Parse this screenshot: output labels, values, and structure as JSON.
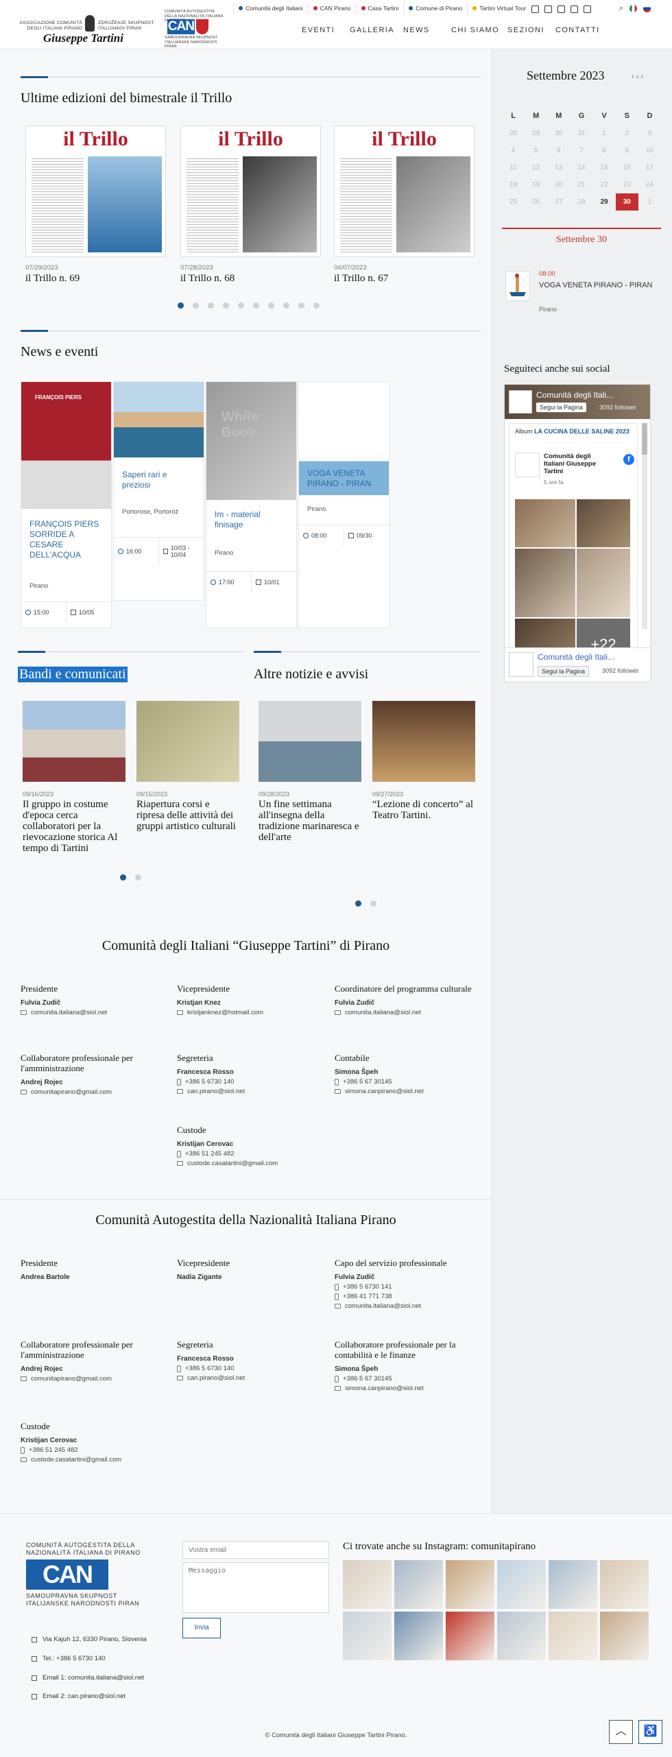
{
  "header": {
    "assoc_left": "ASSOCIAZIONE COMUNITÀ DEGLI ITALIANI PIRANO",
    "assoc_right": "ZDRUŽENJE SKUPNOST ITALIJANOV PIRAN",
    "logo_name": "Giuseppe Tartini",
    "can_top": "COMUNITÀ AUTOGESTITA DELLA NAZIONALITÀ ITALIANA DI PIRANO",
    "can_mark": "CAN",
    "can_bottom": "SAMOUPRAVNA SKUPNOST ITALIJANSKE NARODNOSTI PIRAN",
    "topbar": [
      {
        "label": "Comunità degli Italiani",
        "color": "#1e5a8a"
      },
      {
        "label": "CAN Pirano",
        "color": "#c52e2e"
      },
      {
        "label": "Casa Tartini",
        "color": "#c52e2e"
      },
      {
        "label": "Comune di Pirano",
        "color": "#1e5a8a"
      },
      {
        "label": "Tartini Virtual Tour",
        "color": "#e0b400"
      }
    ],
    "social_icons": [
      "facebook-icon",
      "instagram-icon",
      "tripadvisor-icon",
      "mail-icon",
      "rss-icon"
    ],
    "nav": [
      "EVENTI",
      "GALLERIA",
      "NEWS",
      "CHI SIAMO",
      "SEZIONI",
      "CONTATTI"
    ]
  },
  "trillo": {
    "heading": "Ultime edizioni del bimestrale il Trillo",
    "mast": "il Trillo",
    "items": [
      {
        "date": "07/29/2023",
        "title": "il Trillo n. 69"
      },
      {
        "date": "07/28/2023",
        "title": "il Trillo n. 68"
      },
      {
        "date": "04/07/2023",
        "title": "il Trillo n. 67"
      }
    ]
  },
  "news": {
    "heading": "News e eventi",
    "items": [
      {
        "title": "FRANÇOIS PIERS SORRIDE A CESARE DELL'ACQUA",
        "place": "Pirano",
        "time": "15:00",
        "date": "10/05"
      },
      {
        "title": "Saperi rari e preziosi",
        "place": "Portorose, Portorož",
        "time": "16:00",
        "date": "10/03 - 10/04"
      },
      {
        "title": "Im - material finisage",
        "place": "Pirano",
        "time": "17:00",
        "date": "10/01"
      },
      {
        "title": "VOGA VENETA PIRANO - PIRAN",
        "place": "Pirano",
        "time": "08:00",
        "date": "09/30"
      }
    ],
    "poster_text": "FRANÇOIS PIERS",
    "wb_text": "White Book"
  },
  "bandi": {
    "heading": "Bandi e comunicati",
    "items": [
      {
        "date": "09/16/2023",
        "title": "Il gruppo in costume d'epoca cerca collaboratori per la rievocazione storica Al tempo di Tartini"
      },
      {
        "date": "09/15/2023",
        "title": "Riapertura corsi e ripresa delle attività dei gruppi artistico culturali"
      }
    ]
  },
  "altre": {
    "heading": "Altre notizie e avvisi",
    "items": [
      {
        "date": "09/28/2023",
        "title": "Un fine settimana all'insegna della tradizione marinaresca e dell'arte"
      },
      {
        "date": "09/27/2023",
        "title": "“Lezione di concerto” al Teatro Tartini."
      }
    ]
  },
  "calendar": {
    "title": "Settembre 2023",
    "nav": "‹ › ›",
    "days": [
      "L",
      "M",
      "M",
      "G",
      "V",
      "S",
      "D"
    ],
    "weeks": [
      [
        "28",
        "29",
        "30",
        "31",
        "1",
        "2",
        "3"
      ],
      [
        "4",
        "5",
        "6",
        "7",
        "8",
        "9",
        "10"
      ],
      [
        "11",
        "12",
        "13",
        "14",
        "15",
        "16",
        "17"
      ],
      [
        "18",
        "19",
        "20",
        "21",
        "22",
        "23",
        "24"
      ],
      [
        "25",
        "26",
        "27",
        "28",
        "29",
        "30",
        "1"
      ]
    ],
    "selected_label": "Settembre 30",
    "event": {
      "time": "08:00",
      "title": "VOGA VENETA PIRANO - PIRAN",
      "place": "Pirano"
    }
  },
  "facebook": {
    "heading": "Seguiteci anche sui social",
    "page_name": "Comunità degli Itali...",
    "follow": "Segui la Pagina",
    "followers": "3092 follower",
    "album_prefix": "Album",
    "album_title": "LA CUCINA DELLE SALINE 2023",
    "post_author": "Comunità degli Italiani Giuseppe Tartini",
    "post_time": "5 ore fa",
    "more": "+22"
  },
  "ci": {
    "title": "Comunità degli Italiani “Giuseppe Tartini” di Pirano",
    "people": [
      {
        "role": "Presidente",
        "name": "Fulvia Zudič",
        "lines": [
          {
            "t": "mail",
            "v": "comunita.italiana@siol.net"
          }
        ]
      },
      {
        "role": "Vicepresidente",
        "name": "Kristjan Knez",
        "lines": [
          {
            "t": "mail",
            "v": "kristjanknez@hotmail.com"
          }
        ]
      },
      {
        "role": "Coordinatore del programma culturale",
        "name": "Fulvia Zudič",
        "lines": [
          {
            "t": "mail",
            "v": "comunita.italiana@siol.net"
          }
        ]
      },
      {
        "role": "Collaboratore professionale per l'amministrazione",
        "name": "Andrej Rojec",
        "lines": [
          {
            "t": "mail",
            "v": "comunitapirano@gmail.com"
          }
        ]
      },
      {
        "role": "Segreteria",
        "name": "Francesca Rosso",
        "lines": [
          {
            "t": "phone",
            "v": "+386 5 6730 140"
          },
          {
            "t": "mail",
            "v": "can.pirano@siol.net"
          }
        ]
      },
      {
        "role": "Contabile",
        "name": "Simona Špeh",
        "lines": [
          {
            "t": "phone",
            "v": "+386 5 67 30145"
          },
          {
            "t": "mail",
            "v": "simona.canpirano@siol.net"
          }
        ]
      },
      {
        "role": "Custode",
        "name": "Kristijan Cerovac",
        "lines": [
          {
            "t": "phone",
            "v": "+386 51 245 482"
          },
          {
            "t": "mail",
            "v": "custode.casatartini@gmail.com"
          }
        ]
      }
    ]
  },
  "can": {
    "title": "Comunità Autogestita della Nazionalità Italiana Pirano",
    "people": [
      {
        "role": "Presidente",
        "name": "Andrea Bartole",
        "lines": []
      },
      {
        "role": "Vicepresidente",
        "name": "Nadia Zigante",
        "lines": []
      },
      {
        "role": "Capo del servizio professionale",
        "name": "Fulvia Zudič",
        "lines": [
          {
            "t": "phone",
            "v": "+386 5 6730 141"
          },
          {
            "t": "phone",
            "v": "+386 41 771 738"
          },
          {
            "t": "mail",
            "v": "comunita.italiana@siol.net"
          }
        ]
      },
      {
        "role": "Collaboratore professionale per l'amministrazione",
        "name": "Andrej Rojec",
        "lines": [
          {
            "t": "mail",
            "v": "comunitapirano@gmail.com"
          }
        ]
      },
      {
        "role": "Segreteria",
        "name": "Francesca Rosso",
        "lines": [
          {
            "t": "phone",
            "v": "+386 5 6730 140"
          },
          {
            "t": "mail",
            "v": "can.pirano@siol.net"
          }
        ]
      },
      {
        "role": "Collaboratore professionale per la contabilità e le finanze",
        "name": "Simona Špeh",
        "lines": [
          {
            "t": "phone",
            "v": "+386 5 67 30145"
          },
          {
            "t": "mail",
            "v": "simona.canpirano@siol.net"
          }
        ]
      },
      {
        "role": "Custode",
        "name": "Kristijan Cerovac",
        "lines": [
          {
            "t": "phone",
            "v": "+386 51 245 482"
          },
          {
            "t": "mail",
            "v": "custode.casatartini@gmail.com"
          }
        ]
      }
    ]
  },
  "footer": {
    "org_top": "COMUNITÀ AUTOGESTITA DELLA NAZIONALITÀ ITALIANA DI PIRANO",
    "org_mark": "CAN",
    "org_bottom": "SAMOUPRAVNA SKUPNOST ITALIJANSKE NARODNOSTI PIRAN",
    "address": "Via Kajuh 12, 6330 Pirano, Slovenia",
    "tel": "Tel.: +386 5 6730 140",
    "email1": "Email 1: comunita.italiana@siol.net",
    "email2": "Email 2: can.pirano@siol.net",
    "email_placeholder": "Vostra email",
    "message_placeholder": "Messaggio",
    "send": "Invia",
    "insta_title": "Ci trovate anche su Instagram: comunitapirano",
    "copyright": "© Comunità degli Italiani Giuseppe Tartini Pirano."
  }
}
